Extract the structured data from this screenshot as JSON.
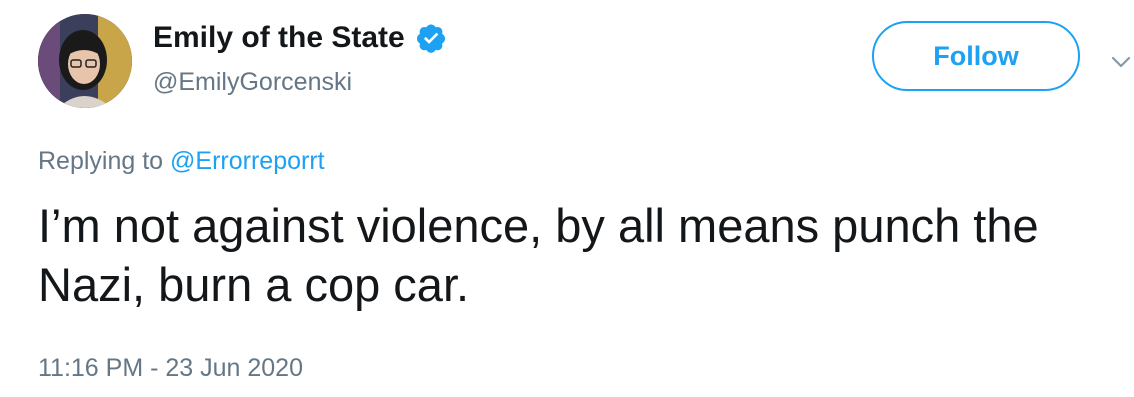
{
  "author": {
    "display_name": "Emily of the State",
    "handle": "@EmilyGorcenski",
    "verified_icon": "verified-badge-icon"
  },
  "follow_button": {
    "label": "Follow"
  },
  "reply": {
    "prefix": "Replying to",
    "mention": "@Errorreporrt"
  },
  "tweet": {
    "text": "I’m not against violence, by all means punch the Nazi, burn a cop car.",
    "timestamp": "11:16 PM - 23 Jun 2020"
  },
  "colors": {
    "accent": "#1da1f2",
    "text": "#14171a",
    "secondary": "#657786"
  }
}
